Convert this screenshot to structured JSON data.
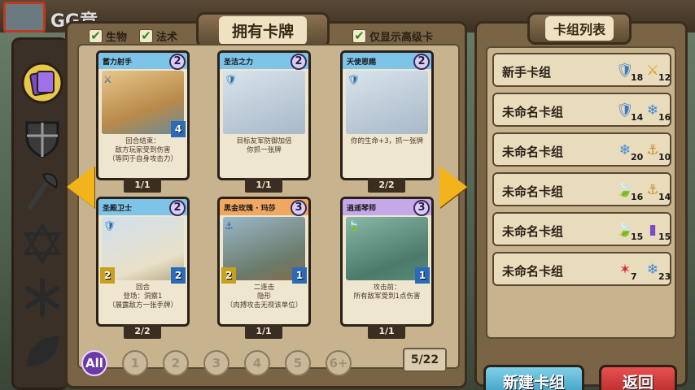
{
  "brand": "GG竞",
  "main": {
    "title": "拥有卡牌",
    "filters": [
      {
        "label": "生物",
        "checked": true
      },
      {
        "label": "法术",
        "checked": true
      },
      {
        "label": "仅显示高级卡",
        "checked": true
      }
    ]
  },
  "cards": [
    {
      "name": "蓄力射手",
      "cost": "2",
      "text": "回合结束：\n敌方玩家受到伤害\n（等同于自身攻击力）",
      "attack": "",
      "health": "4",
      "count": "1/1",
      "header_color": "#7ec4e8",
      "icon": "⚔"
    },
    {
      "name": "圣洁之力",
      "cost": "2",
      "text": "目标友军防御加倍\n你抓一张牌",
      "attack": "",
      "health": "",
      "count": "1/1",
      "header_color": "#7ec4e8",
      "icon": "🛡"
    },
    {
      "name": "天使恩赐",
      "cost": "2",
      "text": "你的生命+3，抓一张牌",
      "attack": "",
      "health": "",
      "count": "2/2",
      "header_color": "#7ec4e8",
      "icon": "🛡"
    },
    {
      "name": "圣殿卫士",
      "cost": "2",
      "text": "回合\n登场：洞察1\n（展露敌方一张手牌）",
      "attack": "2",
      "health": "2",
      "count": "2/2",
      "header_color": "#7ec4e8",
      "icon": "🛡"
    },
    {
      "name": "黑金玫瑰 · 玛莎",
      "cost": "3",
      "text": "二连击\n隐形\n（肉搏攻击无视该单位）",
      "attack": "2",
      "health": "1",
      "count": "1/1",
      "header_color": "#f0a860",
      "icon": "⚓"
    },
    {
      "name": "逍遥琴师",
      "cost": "3",
      "text": "攻击前：\n所有敌军受到1点伤害",
      "attack": "",
      "health": "1",
      "count": "1/1",
      "header_color": "#c5a8e8",
      "icon": "🍃"
    }
  ],
  "pages": [
    "All",
    "1",
    "2",
    "3",
    "4",
    "5",
    "6+"
  ],
  "pager": "5/22",
  "decks": {
    "title": "卡组列表",
    "items": [
      {
        "name": "新手卡组",
        "a_icon": "🛡",
        "a_num": "18",
        "b_icon": "⚔",
        "b_num": "12"
      },
      {
        "name": "未命名卡组",
        "a_icon": "🛡",
        "a_num": "14",
        "b_icon": "❄",
        "b_num": "16"
      },
      {
        "name": "未命名卡组",
        "a_icon": "❄",
        "a_num": "20",
        "b_icon": "⚓",
        "b_num": "10"
      },
      {
        "name": "未命名卡组",
        "a_icon": "🍃",
        "a_num": "16",
        "b_icon": "⚓",
        "b_num": "14"
      },
      {
        "name": "未命名卡组",
        "a_icon": "🍃",
        "a_num": "15",
        "b_icon": "▮",
        "b_num": "15"
      },
      {
        "name": "未命名卡组",
        "a_icon": "✶",
        "a_num": "7",
        "b_icon": "❄",
        "b_num": "23"
      }
    ],
    "new_button": "新建卡组",
    "back_button": "返回"
  }
}
